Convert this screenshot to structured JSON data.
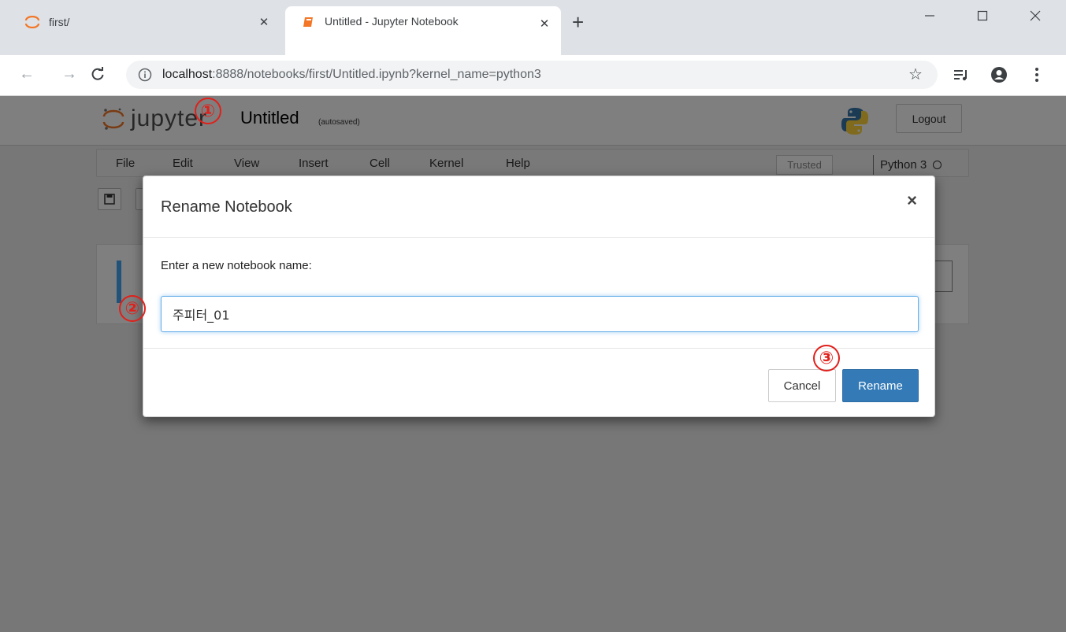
{
  "browser": {
    "tabs": [
      {
        "title": "first/",
        "active": false
      },
      {
        "title": "Untitled - Jupyter Notebook",
        "active": true
      }
    ],
    "new_tab": "+",
    "address": {
      "host": "localhost",
      "rest": ":8888/notebooks/first/Untitled.ipynb?kernel_name=python3"
    }
  },
  "jupyter": {
    "logo_text": "jupyter",
    "notebook_name": "Untitled",
    "autosave_status": "(autosaved)",
    "logout_label": "Logout",
    "menu": [
      "File",
      "Edit",
      "View",
      "Insert",
      "Cell",
      "Kernel",
      "Help"
    ],
    "trusted_label": "Trusted",
    "kernel_label": "Python 3"
  },
  "modal": {
    "title": "Rename Notebook",
    "close_symbol": "×",
    "label": "Enter a new notebook name:",
    "input_value": "주피터_01",
    "cancel_label": "Cancel",
    "rename_label": "Rename"
  },
  "markers": [
    "①",
    "②",
    "③"
  ],
  "colors": {
    "accent": "#337ab7",
    "marker": "#e0201b",
    "jupyter_orange": "#f37726"
  }
}
